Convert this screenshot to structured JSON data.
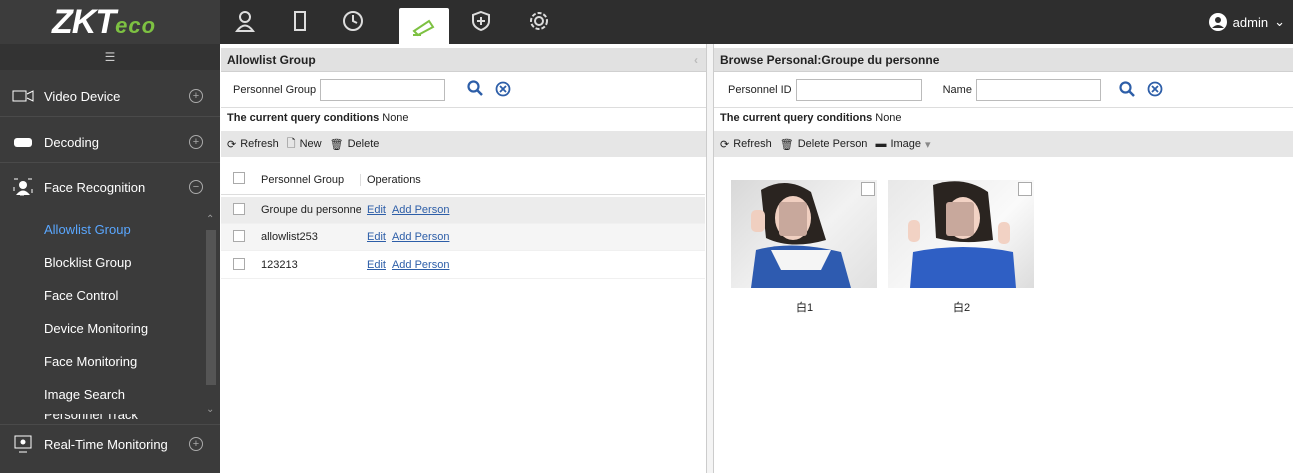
{
  "header": {
    "logo_main": "ZKT",
    "logo_sub": "eco",
    "icons": [
      "user-icon",
      "door-icon",
      "clock-icon",
      "camera-icon",
      "shield-icon",
      "gear-icon"
    ],
    "user_label": "admin"
  },
  "sidebar": {
    "modules": [
      {
        "label": "Video Device"
      },
      {
        "label": "Decoding"
      },
      {
        "label": "Face Recognition"
      },
      {
        "label": "Real-Time Monitoring"
      }
    ],
    "sub_items": [
      "Allowlist Group",
      "Blocklist Group",
      "Face Control",
      "Device Monitoring",
      "Face Monitoring",
      "Image Search",
      "Personnel Track"
    ]
  },
  "left_panel": {
    "title": "Allowlist Group",
    "search_label": "Personnel Group",
    "cond_label": "The current query conditions",
    "cond_value": "None",
    "toolbar": {
      "refresh": "Refresh",
      "new": "New",
      "delete": "Delete"
    },
    "columns": [
      "Personnel Group",
      "Operations"
    ],
    "rows": [
      {
        "group": "Groupe du personne",
        "edit": "Edit",
        "add": "Add Person"
      },
      {
        "group": "allowlist253",
        "edit": "Edit",
        "add": "Add Person"
      },
      {
        "group": "123213",
        "edit": "Edit",
        "add": "Add Person"
      }
    ]
  },
  "right_panel": {
    "title": "Browse Personal:Groupe du personne",
    "id_label": "Personnel ID",
    "name_label": "Name",
    "cond_label": "The current query conditions",
    "cond_value": "None",
    "toolbar": {
      "refresh": "Refresh",
      "delete_person": "Delete Person",
      "image": "Image"
    },
    "photos": [
      {
        "caption": "白1"
      },
      {
        "caption": "白2"
      }
    ]
  },
  "colors": {
    "accent": "#7dc142",
    "link": "#2d5ea8",
    "active_sub": "#5aa7ff"
  }
}
